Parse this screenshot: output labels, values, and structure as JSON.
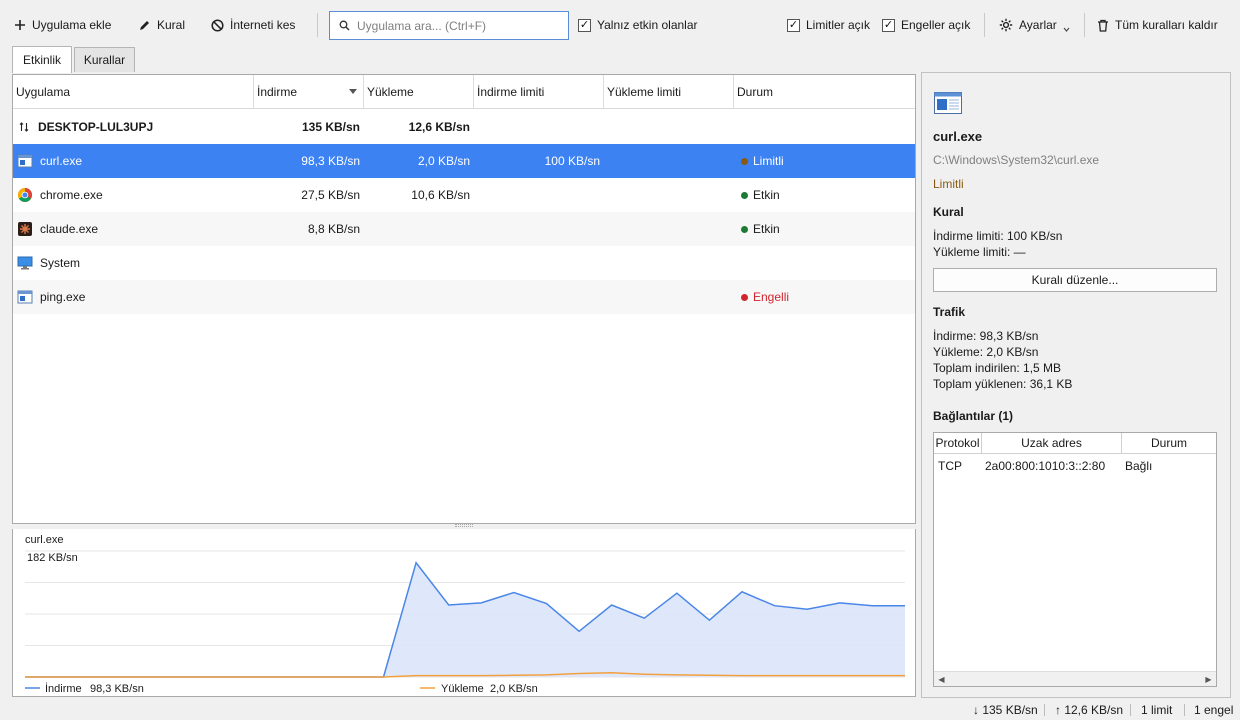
{
  "toolbar": {
    "add_app": "Uygulama ekle",
    "rule": "Kural",
    "cut_internet": "İnterneti kes",
    "search_placeholder": "Uygulama ara... (Ctrl+F)",
    "only_active": "Yalnız etkin olanlar",
    "limits_on": "Limitler açık",
    "blocks_on": "Engeller açık",
    "settings": "Ayarlar",
    "remove_all_rules": "Tüm kuralları kaldır"
  },
  "tabs": [
    {
      "label": "Etkinlik",
      "active": true
    },
    {
      "label": "Kurallar",
      "active": false
    }
  ],
  "table": {
    "columns": [
      "Uygulama",
      "İndirme",
      "Yükleme",
      "İndirme limiti",
      "Yükleme limiti",
      "Durum"
    ],
    "total": {
      "name": "DESKTOP-LUL3UPJ",
      "download": "135 KB/sn",
      "upload": "12,6 KB/sn"
    },
    "rows": [
      {
        "name": "curl.exe",
        "icon": "console-app-icon",
        "download": "98,3 KB/sn",
        "upload": "2,0 KB/sn",
        "dl_limit": "100 KB/sn",
        "ul_limit": "",
        "status": "Limitli",
        "status_color": "#8a5a14",
        "selected": true
      },
      {
        "name": "chrome.exe",
        "icon": "chrome-icon",
        "download": "27,5 KB/sn",
        "upload": "10,6 KB/sn",
        "dl_limit": "",
        "ul_limit": "",
        "status": "Etkin",
        "status_color": "#1d7a35",
        "selected": false
      },
      {
        "name": "claude.exe",
        "icon": "claude-icon",
        "download": "8,8 KB/sn",
        "upload": "",
        "dl_limit": "",
        "ul_limit": "",
        "status": "Etkin",
        "status_color": "#1d7a35",
        "selected": false
      },
      {
        "name": "System",
        "icon": "monitor-icon",
        "download": "",
        "upload": "",
        "dl_limit": "",
        "ul_limit": "",
        "status": "",
        "status_color": "",
        "selected": false
      },
      {
        "name": "ping.exe",
        "icon": "console-app-icon",
        "download": "",
        "upload": "",
        "dl_limit": "",
        "ul_limit": "",
        "status": "Engelli",
        "status_color": "#d1242f",
        "selected": false
      }
    ]
  },
  "chart_data": {
    "type": "area",
    "title": "curl.exe",
    "ymax_label": "182 KB/sn",
    "ylim": [
      0,
      182
    ],
    "series": [
      {
        "name": "İndirme",
        "current": "98,3 KB/sn",
        "color": "#4a86e8",
        "values": [
          0,
          0,
          0,
          0,
          0,
          0,
          0,
          0,
          0,
          0,
          0,
          0,
          165,
          104,
          107,
          122,
          106,
          66,
          104,
          85,
          121,
          82,
          123,
          103,
          98,
          107,
          103,
          103
        ]
      },
      {
        "name": "Yükleme",
        "current": "2,0 KB/sn",
        "color": "#f2a03d",
        "values": [
          0,
          0,
          0,
          0,
          0,
          0,
          0,
          0,
          0,
          0,
          0,
          0,
          2,
          2,
          2,
          2.5,
          3,
          5,
          6,
          4,
          3,
          2.5,
          2,
          2,
          2,
          2,
          2,
          2
        ]
      }
    ]
  },
  "detail": {
    "app_name": "curl.exe",
    "path": "C:\\Windows\\System32\\curl.exe",
    "state": "Limitli",
    "state_color": "#8a5a14",
    "rule_heading": "Kural",
    "dl_limit": "İndirme limiti: 100 KB/sn",
    "ul_limit": "Yükleme limiti: —",
    "edit_rule": "Kuralı düzenle...",
    "traffic_heading": "Trafik",
    "traffic_dl": "İndirme: 98,3 KB/sn",
    "traffic_ul": "Yükleme: 2,0 KB/sn",
    "total_dl": "Toplam indirilen: 1,5 MB",
    "total_ul": "Toplam yüklenen: 36,1 KB",
    "connections_heading": "Bağlantılar (1)",
    "conn_columns": [
      "Protokol",
      "Uzak adres",
      "Durum"
    ],
    "connections": [
      {
        "protocol": "TCP",
        "remote": "2a00:800:1010:3::2:80",
        "state": "Bağlı"
      }
    ]
  },
  "statusbar": {
    "down": "↓ 135 KB/sn",
    "up": "↑ 12,6 KB/sn",
    "limits": "1 limit",
    "blocks": "1 engel"
  }
}
